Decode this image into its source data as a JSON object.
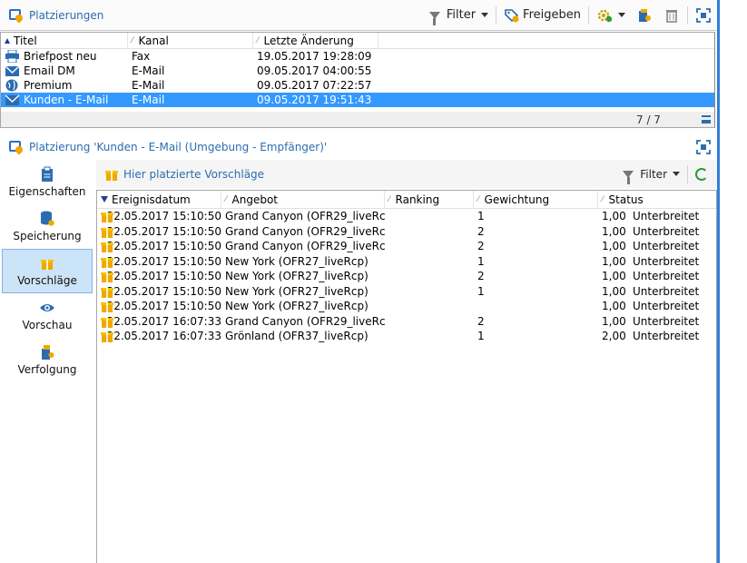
{
  "top_panel": {
    "title": "Platzierungen",
    "toolbar": {
      "filter_label": "Filter",
      "release_label": "Freigeben"
    },
    "columns": [
      "Titel",
      "Kanal",
      "Letzte Änderung"
    ],
    "rows": [
      {
        "icon": "printer-icon",
        "title": "Briefpost neu",
        "channel": "Fax",
        "modified": "19.05.2017 19:28:09"
      },
      {
        "icon": "envelope-icon",
        "title": "Email DM",
        "channel": "E-Mail",
        "modified": "09.05.2017 04:00:55"
      },
      {
        "icon": "globe-icon",
        "title": "Premium",
        "channel": "E-Mail",
        "modified": "09.05.2017 07:22:57"
      },
      {
        "icon": "envelope-icon",
        "title": "Kunden - E-Mail",
        "channel": "E-Mail",
        "modified": "09.05.2017 19:51:43",
        "selected": true
      }
    ],
    "count": "7 / 7"
  },
  "bottom_panel": {
    "title": "Platzierung 'Kunden - E-Mail (Umgebung - Empfänger)'",
    "sidebar": [
      {
        "label": "Eigenschaften",
        "icon": "clipboard-icon"
      },
      {
        "label": "Speicherung",
        "icon": "database-icon"
      },
      {
        "label": "Vorschläge",
        "icon": "gift-icon",
        "active": true
      },
      {
        "label": "Vorschau",
        "icon": "eye-icon"
      },
      {
        "label": "Verfolgung",
        "icon": "tracking-icon"
      }
    ],
    "subtoolbar": {
      "label": "Hier platzierte Vorschläge",
      "filter_label": "Filter"
    },
    "columns": [
      "Ereignisdatum",
      "Angebot",
      "Ranking",
      "Gewichtung",
      "Status"
    ],
    "rows": [
      {
        "date": "22.05.2017 15:10:50",
        "offer": "Grand Canyon (OFR29_liveRcp)",
        "ranking": "1",
        "weight": "1,00",
        "status": "Unterbreitet"
      },
      {
        "date": "22.05.2017 15:10:50",
        "offer": "Grand Canyon (OFR29_liveRcp)",
        "ranking": "2",
        "weight": "1,00",
        "status": "Unterbreitet"
      },
      {
        "date": "22.05.2017 15:10:50",
        "offer": "Grand Canyon (OFR29_liveRcp)",
        "ranking": "2",
        "weight": "1,00",
        "status": "Unterbreitet"
      },
      {
        "date": "22.05.2017 15:10:50",
        "offer": "New York (OFR27_liveRcp)",
        "ranking": "1",
        "weight": "1,00",
        "status": "Unterbreitet"
      },
      {
        "date": "22.05.2017 15:10:50",
        "offer": "New York (OFR27_liveRcp)",
        "ranking": "2",
        "weight": "1,00",
        "status": "Unterbreitet"
      },
      {
        "date": "22.05.2017 15:10:50",
        "offer": "New York (OFR27_liveRcp)",
        "ranking": "1",
        "weight": "1,00",
        "status": "Unterbreitet"
      },
      {
        "date": "22.05.2017 15:10:50",
        "offer": "New York (OFR27_liveRcp)",
        "ranking": "",
        "weight": "1,00",
        "status": "Unterbreitet"
      },
      {
        "date": "22.05.2017 16:07:33",
        "offer": "Grand Canyon (OFR29_liveRcp)",
        "ranking": "2",
        "weight": "1,00",
        "status": "Unterbreitet"
      },
      {
        "date": "22.05.2017 16:07:33",
        "offer": "Grönland (OFR37_liveRcp)",
        "ranking": "1",
        "weight": "2,00",
        "status": "Unterbreitet"
      }
    ]
  },
  "colors": {
    "accent": "#2b6cb0",
    "selection": "#3399ff",
    "sidebar_active": "#cce4f7",
    "gift": "#f0a800",
    "refresh": "#2e9a3a"
  }
}
